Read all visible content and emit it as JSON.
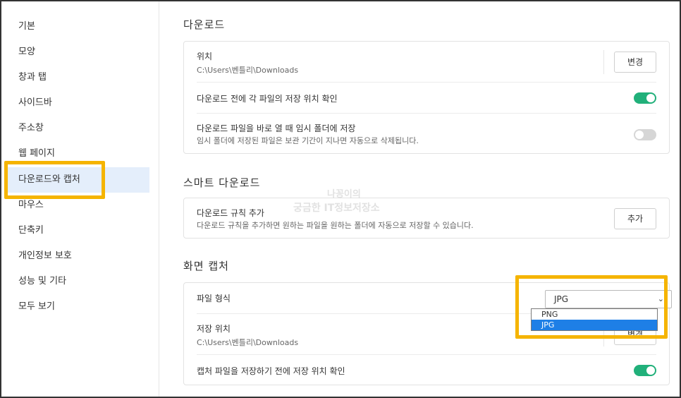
{
  "sidebar": {
    "items": [
      {
        "label": "기본"
      },
      {
        "label": "모양"
      },
      {
        "label": "창과 탭"
      },
      {
        "label": "사이드바"
      },
      {
        "label": "주소창"
      },
      {
        "label": "웹 페이지"
      },
      {
        "label": "다운로드와 캡처"
      },
      {
        "label": "마우스"
      },
      {
        "label": "단축키"
      },
      {
        "label": "개인정보 보호"
      },
      {
        "label": "성능 및 기타"
      },
      {
        "label": "모두 보기"
      }
    ],
    "active_index": 6
  },
  "download": {
    "title": "다운로드",
    "location": {
      "title": "위치",
      "path": "C:\\Users\\벤틀리\\Downloads",
      "button": "변경"
    },
    "confirm": {
      "title": "다운로드 전에 각 파일의 저장 위치 확인",
      "enabled": true
    },
    "temp": {
      "title": "다운로드 파일을 바로 열 때 임시 폴더에 저장",
      "sub": "임시 폴더에 저장된 파일은 보관 기간이 지나면 자동으로 삭제됩니다.",
      "enabled": false
    }
  },
  "smart": {
    "title": "스마트 다운로드",
    "rules": {
      "title": "다운로드 규칙 추가",
      "sub": "다운로드 규칙을 추가하면 원하는 파일을 원하는 폴더에 자동으로 저장할 수 있습니다.",
      "button": "추가"
    }
  },
  "capture": {
    "title": "화면 캡처",
    "format": {
      "title": "파일 형식",
      "selected": "JPG",
      "options": [
        "PNG",
        "JPG"
      ],
      "highlighted": "JPG"
    },
    "location": {
      "title": "저장 위치",
      "path": "C:\\Users\\벤틀리\\Downloads",
      "button": "변경"
    },
    "confirm": {
      "title": "캡처 파일을 저장하기 전에 저장 위치 확인",
      "enabled": true
    }
  },
  "watermark": {
    "line1": "나꽁이의",
    "line2": "궁금한 IT정보저장소"
  },
  "colors": {
    "accent": "#f5b400",
    "toggle_on": "#21b07a",
    "active_bg": "#e4eefb",
    "option_selected": "#1e7fe6"
  }
}
